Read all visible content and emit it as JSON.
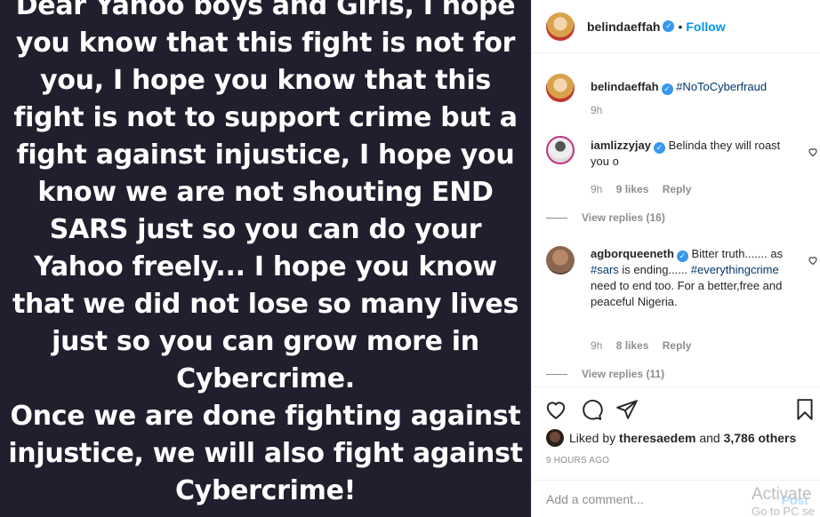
{
  "post": {
    "text_lines": [
      "Dear Yahoo boys and Girls, I hope",
      "you know that this fight is not for",
      "you, I hope you know that this",
      "fight is not to support crime but a",
      "fight against injustice, I hope you",
      "know we are not shouting END",
      "SARS just so you can do your",
      "Yahoo freely... I hope you know",
      "that we did not lose so many lives",
      "just so you can grow more in",
      "Cybercrime.",
      "Once we are done fighting against",
      "injustice, we will also fight against",
      "Cybercrime!"
    ]
  },
  "header": {
    "username": "belindaeffah",
    "separator": "•",
    "follow_label": "Follow"
  },
  "caption": {
    "username": "belindaeffah",
    "text": "#NoToCyberfraud",
    "time": "9h"
  },
  "comments": [
    {
      "username": "iamlizzyjay",
      "text": "Belinda they will roast you o",
      "time": "9h",
      "likes": "9 likes",
      "reply_label": "Reply",
      "view_replies": "View replies (16)"
    },
    {
      "username": "agborqueeneth",
      "text_before": "Bitter truth....... as ",
      "tag1": "#sars",
      "text_mid": " is ending...... ",
      "tag2": "#everythingcrime",
      "text_after": " need to end too. For a better,free and peaceful Nigeria.",
      "time": "9h",
      "likes": "8 likes",
      "reply_label": "Reply",
      "view_replies": "View replies (11)"
    }
  ],
  "likes": {
    "prefix": "Liked by",
    "user": "theresaedem",
    "and": "and",
    "others": "3,786 others"
  },
  "time_ago": "9 HOURS AGO",
  "add_comment": {
    "placeholder": "Add a comment...",
    "post_label": "Post"
  },
  "watermark": {
    "line1": "Activate",
    "line2": "Go to PC se"
  },
  "colors": {
    "post_bg": "#1f1f2e",
    "link_blue": "#0095f6",
    "hashtag": "#00376b",
    "verified": "#3897f0"
  }
}
